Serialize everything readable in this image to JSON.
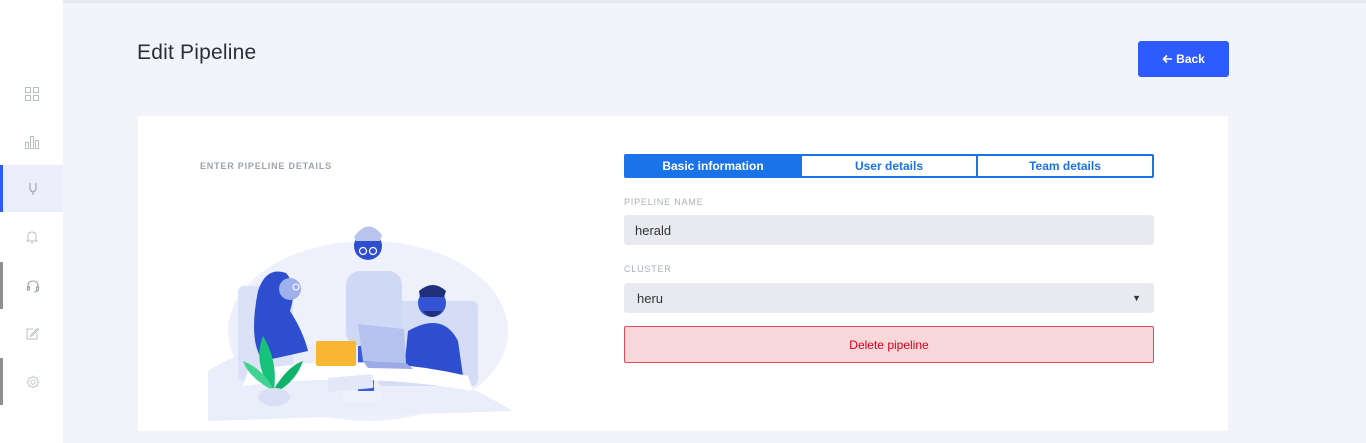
{
  "sidebar": {
    "items": [
      {
        "icon": "dashboard-grid-icon"
      },
      {
        "icon": "bar-chart-icon"
      },
      {
        "icon": "pipeline-branch-icon",
        "active": true
      },
      {
        "icon": "bell-icon"
      },
      {
        "icon": "headset-icon"
      },
      {
        "icon": "edit-icon"
      },
      {
        "icon": "settings-icon"
      }
    ]
  },
  "header": {
    "title": "Edit Pipeline",
    "back_label": "Back"
  },
  "card": {
    "section_label": "ENTER PIPELINE DETAILS",
    "tabs": [
      {
        "label": "Basic information",
        "active": true
      },
      {
        "label": "User details"
      },
      {
        "label": "Team details"
      }
    ],
    "pipeline_name_label": "PIPELINE NAME",
    "pipeline_name_value": "herald",
    "cluster_label": "CLUSTER",
    "cluster_value": "heru",
    "delete_label": "Delete pipeline"
  },
  "colors": {
    "accent": "#2d5bff",
    "tab_blue": "#1a73e8",
    "danger_text": "#d6001c",
    "danger_bg": "#f8d7da"
  }
}
